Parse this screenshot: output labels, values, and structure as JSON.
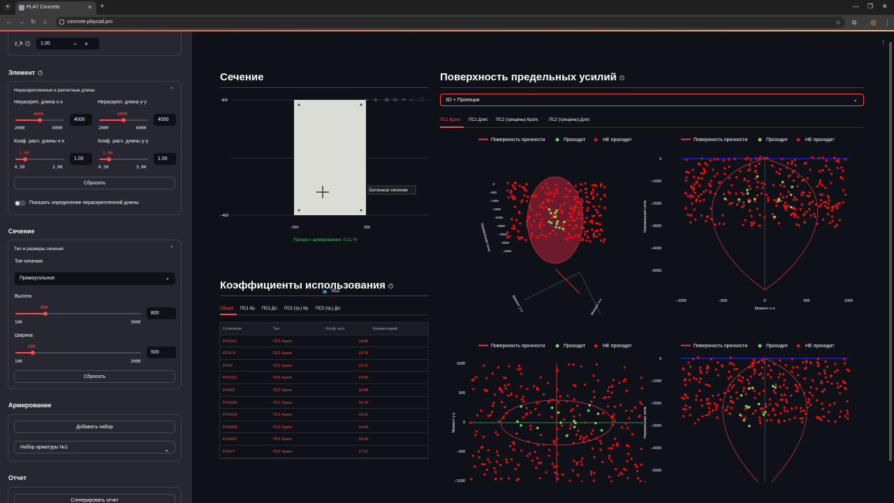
{
  "browser": {
    "tab_title": "PLAY Concrete",
    "url": "concrete.playcad.pro"
  },
  "colors": {
    "accent": "#ff4b4b",
    "pass": "#7cd35e",
    "fail": "#e81010",
    "surface": "#e13c5a",
    "panel": "#262730",
    "bg": "#0e1117"
  },
  "sidebar": {
    "gamma_label": "γ_b",
    "gamma_value": "1.00",
    "minus": "−",
    "plus": "+",
    "element_heading": "Элемент",
    "lengths_expander": "Нераскрепленные и расчетные длины",
    "len_x_label": "Нераскреп. длина x-x",
    "len_x_value": "4000",
    "len_x_min": "2000",
    "len_x_max": "6000",
    "len_x_input": "4000",
    "len_y_label": "Нераскреп. длина y-y",
    "len_y_value": "4000",
    "len_y_min": "2000",
    "len_y_max": "6000",
    "len_y_input": "4000",
    "coef_x_label": "Коэф. расч. длины x-x",
    "coef_x_value": "1.00",
    "coef_x_min": "0.50",
    "coef_x_max": "3.00",
    "coef_x_input": "1.00",
    "coef_y_label": "Коэф. расч. длины y-y",
    "coef_y_value": "1.00",
    "coef_y_min": "0.50",
    "coef_y_max": "3.00",
    "coef_y_input": "1.00",
    "reset_label": "Сбросить",
    "toggle_label": "Показать определение нераскрепленной длины",
    "section_heading": "Сечение",
    "section_expander": "Тип и размеры сечения",
    "section_type_label": "Тип сечения",
    "section_type_value": "Прямоугольное",
    "height_label": "Высота",
    "height_value": "800",
    "height_min": "100",
    "height_max": "3000",
    "height_input": "800",
    "width_label": "Ширина",
    "width_value": "500",
    "width_min": "100",
    "width_max": "3000",
    "width_input": "500",
    "reset2_label": "Сбросить",
    "reinf_heading": "Армирование",
    "add_set_label": "Добавить набор",
    "rebar_set_label": "Набор арматуры №1",
    "report_heading": "Отчет",
    "gen_report_label": "Сгенерировать отчет"
  },
  "section": {
    "title": "Сечение",
    "y_ticks": [
      "400",
      "−400"
    ],
    "x_ticks": [
      "−250",
      "250"
    ],
    "tooltip": "Бетонное сечение",
    "reinf_percent": "Процент армирования: 0.11 %",
    "legend_bar": "d12"
  },
  "coeffs": {
    "title": "Коэффициенты использования",
    "tabs": [
      "Общие",
      "ПС1 Кр.",
      "ПС1 Дл.",
      "ПС2 (тр.) Кр.",
      "ПС2 (тр.) Дл."
    ],
    "columns": [
      "Сочетание",
      "Тип",
      "↓ Коэф. исп.",
      "Комментарий"
    ],
    "rows": [
      {
        "c": "РСН151",
        "t": "ПС1 Кратк.",
        "k": "19.88"
      },
      {
        "c": "РСН79",
        "t": "ПС1 Кратк.",
        "k": "19.79"
      },
      {
        "c": "РСН7",
        "t": "ПС1 Кратк.",
        "k": "19.12"
      },
      {
        "c": "РСН112",
        "t": "ПС1 Кратк.",
        "k": "19.00"
      },
      {
        "c": "РСН91",
        "t": "ПС1 Кратк.",
        "k": "18.98"
      },
      {
        "c": "РСН140",
        "t": "ПС1 Кратк.",
        "k": "18.74"
      },
      {
        "c": "РСН122",
        "t": "ПС1 Кратк.",
        "k": "18.21"
      },
      {
        "c": "РСН203",
        "t": "ПС1 Кратк.",
        "k": "18.04"
      },
      {
        "c": "РСН207",
        "t": "ПС1 Кратк.",
        "k": "18.03"
      },
      {
        "c": "РСН77",
        "t": "ПС1 Кратк.",
        "k": "17.51"
      }
    ]
  },
  "surface": {
    "title": "Поверхность предельных усилий",
    "view_select": "3D + Проекции",
    "tabs": [
      "ПС1 Кратк.",
      "ПС1 Длит.",
      "ПС2 (трещины) Кратк.",
      "ПС2 (трещины) Длит."
    ],
    "legend": [
      "Поверхность прочности",
      "Проходит",
      "НЕ проходит"
    ],
    "axes": {
      "normal": "Нормальная сила",
      "mx": "Момент x-x",
      "my": "Момент y-y"
    },
    "plot3d_ticks": [
      "0",
      "−500",
      "−1000",
      "−1500",
      "−2000",
      "−2500",
      "−3000",
      "−3500",
      "−4000"
    ],
    "mx_ticks": [
      "−1000",
      "−500",
      "0",
      "500",
      "1000"
    ],
    "n_ticks": [
      "0",
      "−1000",
      "−2000",
      "−3000",
      "−4000",
      "−5000"
    ],
    "my_ticks": [
      "1000",
      "500",
      "0",
      "−500",
      "−1000"
    ]
  }
}
